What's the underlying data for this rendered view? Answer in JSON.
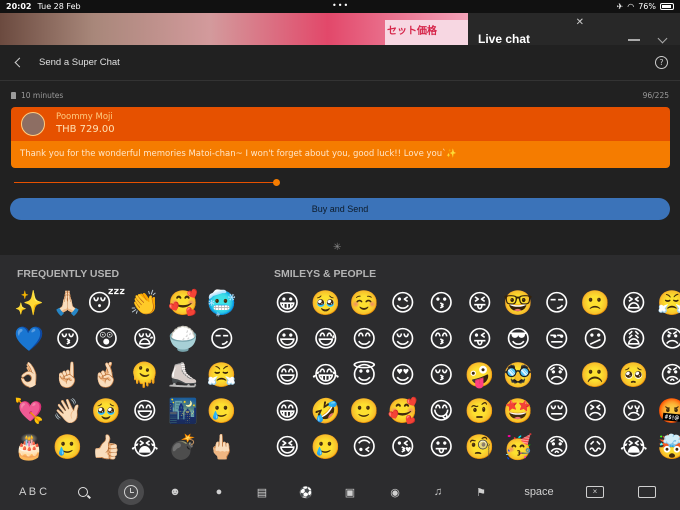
{
  "status_bar": {
    "time": "20:02",
    "date": "Tue 28 Feb",
    "battery": "76%"
  },
  "video": {
    "banner_text": "セット価格"
  },
  "chat_header": {
    "title": "Live chat"
  },
  "panel": {
    "title": "Send a Super Chat",
    "pin_time": "10 minutes",
    "char_count": "96/225",
    "help_label": "?"
  },
  "super_chat": {
    "name": "Poommy Moji",
    "amount": "THB 729.00",
    "message": "Thank you for the wonderful memories Matoi-chan~ I won't forget about you, good luck!! Love you`✨"
  },
  "buy_button": {
    "label": "Buy and Send"
  },
  "keyboard": {
    "frequent_title": "FREQUENTLY USED",
    "smileys_title": "SMILEYS & PEOPLE",
    "frequent": [
      "✨",
      "🙏🏻",
      "😴",
      "👏",
      "🥰",
      "🥶",
      "💙",
      "😚",
      "😲",
      "😪",
      "🍚",
      "😏",
      "👌🏻",
      "☝🏻",
      "🤞🏻",
      "🫠",
      "⛸️",
      "😤",
      "💘",
      "👋🏻",
      "🥹",
      "😄",
      "🌃",
      "🥲",
      "🎂",
      "🥲",
      "👍🏻",
      "😭",
      "💣",
      "🖕🏻"
    ],
    "smileys": [
      "😀",
      "🥹",
      "☺️",
      "😉",
      "😗",
      "😝",
      "🤓",
      "😏",
      "🙁",
      "😫",
      "😤",
      "😃",
      "😅",
      "😊",
      "😌",
      "😙",
      "😜",
      "😎",
      "😒",
      "😕",
      "😩",
      "😠",
      "😄",
      "😂",
      "😇",
      "😍",
      "😚",
      "🤪",
      "🥸",
      "😞",
      "☹️",
      "🥺",
      "😡",
      "😁",
      "🤣",
      "🙂",
      "🥰",
      "😋",
      "🤨",
      "🤩",
      "😔",
      "😣",
      "😢",
      "🤬",
      "😆",
      "🥲",
      "🙃",
      "😘",
      "😛",
      "🧐",
      "🥳",
      "😟",
      "😖",
      "😭",
      "🤯"
    ],
    "abc_label": "A B C",
    "space_label": "space",
    "categories": [
      "smiley-icon",
      "animal-icon",
      "food-icon",
      "activity-icon",
      "travel-icon",
      "object-icon",
      "symbol-icon",
      "flag-icon"
    ]
  }
}
